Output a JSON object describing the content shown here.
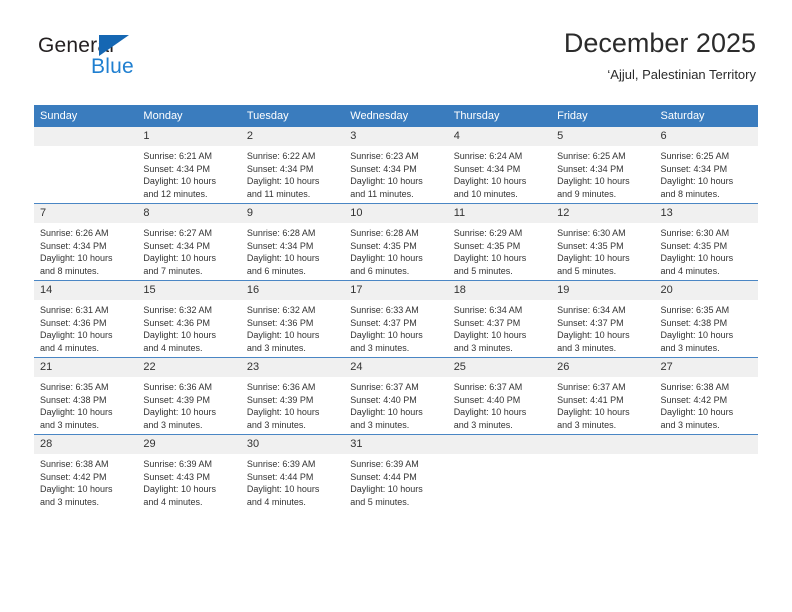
{
  "logo": {
    "text_primary": "General",
    "text_secondary": "Blue",
    "primary_color": "#231f20",
    "secondary_color": "#1f7fd0",
    "triangle_color": "#1567b3"
  },
  "header": {
    "title": "December 2025",
    "subtitle": "‘Ajjul, Palestinian Territory",
    "accent_color": "#3a7cbe"
  },
  "weekday_headers": [
    "Sunday",
    "Monday",
    "Tuesday",
    "Wednesday",
    "Thursday",
    "Friday",
    "Saturday"
  ],
  "weeks": [
    [
      {
        "day": "",
        "lines": []
      },
      {
        "day": "1",
        "lines": [
          "Sunrise: 6:21 AM",
          "Sunset: 4:34 PM",
          "Daylight: 10 hours",
          "and 12 minutes."
        ]
      },
      {
        "day": "2",
        "lines": [
          "Sunrise: 6:22 AM",
          "Sunset: 4:34 PM",
          "Daylight: 10 hours",
          "and 11 minutes."
        ]
      },
      {
        "day": "3",
        "lines": [
          "Sunrise: 6:23 AM",
          "Sunset: 4:34 PM",
          "Daylight: 10 hours",
          "and 11 minutes."
        ]
      },
      {
        "day": "4",
        "lines": [
          "Sunrise: 6:24 AM",
          "Sunset: 4:34 PM",
          "Daylight: 10 hours",
          "and 10 minutes."
        ]
      },
      {
        "day": "5",
        "lines": [
          "Sunrise: 6:25 AM",
          "Sunset: 4:34 PM",
          "Daylight: 10 hours",
          "and 9 minutes."
        ]
      },
      {
        "day": "6",
        "lines": [
          "Sunrise: 6:25 AM",
          "Sunset: 4:34 PM",
          "Daylight: 10 hours",
          "and 8 minutes."
        ]
      }
    ],
    [
      {
        "day": "7",
        "lines": [
          "Sunrise: 6:26 AM",
          "Sunset: 4:34 PM",
          "Daylight: 10 hours",
          "and 8 minutes."
        ]
      },
      {
        "day": "8",
        "lines": [
          "Sunrise: 6:27 AM",
          "Sunset: 4:34 PM",
          "Daylight: 10 hours",
          "and 7 minutes."
        ]
      },
      {
        "day": "9",
        "lines": [
          "Sunrise: 6:28 AM",
          "Sunset: 4:34 PM",
          "Daylight: 10 hours",
          "and 6 minutes."
        ]
      },
      {
        "day": "10",
        "lines": [
          "Sunrise: 6:28 AM",
          "Sunset: 4:35 PM",
          "Daylight: 10 hours",
          "and 6 minutes."
        ]
      },
      {
        "day": "11",
        "lines": [
          "Sunrise: 6:29 AM",
          "Sunset: 4:35 PM",
          "Daylight: 10 hours",
          "and 5 minutes."
        ]
      },
      {
        "day": "12",
        "lines": [
          "Sunrise: 6:30 AM",
          "Sunset: 4:35 PM",
          "Daylight: 10 hours",
          "and 5 minutes."
        ]
      },
      {
        "day": "13",
        "lines": [
          "Sunrise: 6:30 AM",
          "Sunset: 4:35 PM",
          "Daylight: 10 hours",
          "and 4 minutes."
        ]
      }
    ],
    [
      {
        "day": "14",
        "lines": [
          "Sunrise: 6:31 AM",
          "Sunset: 4:36 PM",
          "Daylight: 10 hours",
          "and 4 minutes."
        ]
      },
      {
        "day": "15",
        "lines": [
          "Sunrise: 6:32 AM",
          "Sunset: 4:36 PM",
          "Daylight: 10 hours",
          "and 4 minutes."
        ]
      },
      {
        "day": "16",
        "lines": [
          "Sunrise: 6:32 AM",
          "Sunset: 4:36 PM",
          "Daylight: 10 hours",
          "and 3 minutes."
        ]
      },
      {
        "day": "17",
        "lines": [
          "Sunrise: 6:33 AM",
          "Sunset: 4:37 PM",
          "Daylight: 10 hours",
          "and 3 minutes."
        ]
      },
      {
        "day": "18",
        "lines": [
          "Sunrise: 6:34 AM",
          "Sunset: 4:37 PM",
          "Daylight: 10 hours",
          "and 3 minutes."
        ]
      },
      {
        "day": "19",
        "lines": [
          "Sunrise: 6:34 AM",
          "Sunset: 4:37 PM",
          "Daylight: 10 hours",
          "and 3 minutes."
        ]
      },
      {
        "day": "20",
        "lines": [
          "Sunrise: 6:35 AM",
          "Sunset: 4:38 PM",
          "Daylight: 10 hours",
          "and 3 minutes."
        ]
      }
    ],
    [
      {
        "day": "21",
        "lines": [
          "Sunrise: 6:35 AM",
          "Sunset: 4:38 PM",
          "Daylight: 10 hours",
          "and 3 minutes."
        ]
      },
      {
        "day": "22",
        "lines": [
          "Sunrise: 6:36 AM",
          "Sunset: 4:39 PM",
          "Daylight: 10 hours",
          "and 3 minutes."
        ]
      },
      {
        "day": "23",
        "lines": [
          "Sunrise: 6:36 AM",
          "Sunset: 4:39 PM",
          "Daylight: 10 hours",
          "and 3 minutes."
        ]
      },
      {
        "day": "24",
        "lines": [
          "Sunrise: 6:37 AM",
          "Sunset: 4:40 PM",
          "Daylight: 10 hours",
          "and 3 minutes."
        ]
      },
      {
        "day": "25",
        "lines": [
          "Sunrise: 6:37 AM",
          "Sunset: 4:40 PM",
          "Daylight: 10 hours",
          "and 3 minutes."
        ]
      },
      {
        "day": "26",
        "lines": [
          "Sunrise: 6:37 AM",
          "Sunset: 4:41 PM",
          "Daylight: 10 hours",
          "and 3 minutes."
        ]
      },
      {
        "day": "27",
        "lines": [
          "Sunrise: 6:38 AM",
          "Sunset: 4:42 PM",
          "Daylight: 10 hours",
          "and 3 minutes."
        ]
      }
    ],
    [
      {
        "day": "28",
        "lines": [
          "Sunrise: 6:38 AM",
          "Sunset: 4:42 PM",
          "Daylight: 10 hours",
          "and 3 minutes."
        ]
      },
      {
        "day": "29",
        "lines": [
          "Sunrise: 6:39 AM",
          "Sunset: 4:43 PM",
          "Daylight: 10 hours",
          "and 4 minutes."
        ]
      },
      {
        "day": "30",
        "lines": [
          "Sunrise: 6:39 AM",
          "Sunset: 4:44 PM",
          "Daylight: 10 hours",
          "and 4 minutes."
        ]
      },
      {
        "day": "31",
        "lines": [
          "Sunrise: 6:39 AM",
          "Sunset: 4:44 PM",
          "Daylight: 10 hours",
          "and 5 minutes."
        ]
      },
      {
        "day": "",
        "lines": []
      },
      {
        "day": "",
        "lines": []
      },
      {
        "day": "",
        "lines": []
      }
    ]
  ]
}
